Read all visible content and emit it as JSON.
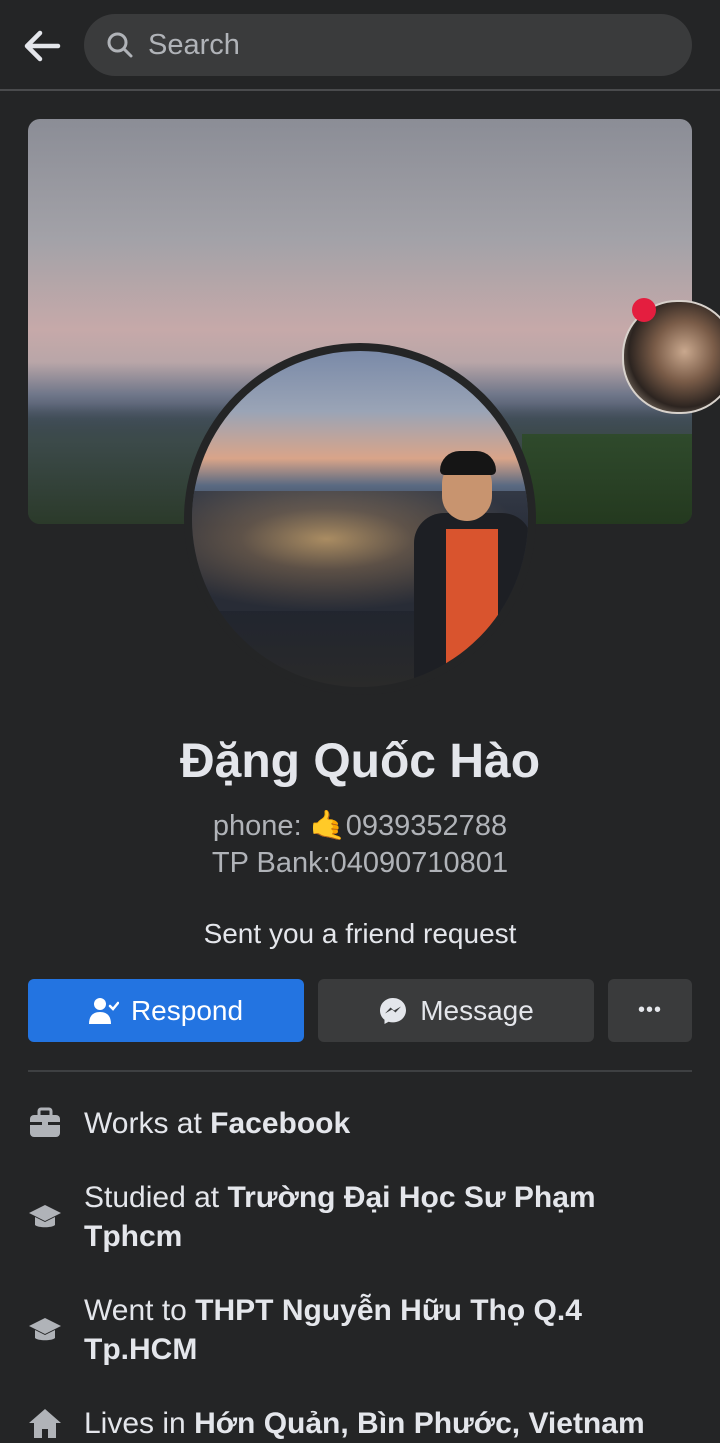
{
  "header": {
    "search_placeholder": "Search",
    "back_icon": "arrow-left-icon",
    "search_icon": "search-icon"
  },
  "profile": {
    "name": "Đặng Quốc Hào",
    "phone_line": "phone: 🤙0939352788",
    "bank_line": "TP Bank:04090710801",
    "request_text": "Sent you a friend request"
  },
  "actions": {
    "respond_label": "Respond",
    "message_label": "Message",
    "more_label": "•••"
  },
  "details": [
    {
      "icon": "briefcase-icon",
      "prefix": "Works at ",
      "value": "Facebook"
    },
    {
      "icon": "graduation-cap-icon",
      "prefix": "Studied at ",
      "value": "Trường Đại Học Sư Phạm Tphcm"
    },
    {
      "icon": "graduation-cap-icon",
      "prefix": "Went to ",
      "value": "THPT Nguyễn Hữu Thọ Q.4 Tp.HCM"
    },
    {
      "icon": "home-icon",
      "prefix": "Lives in ",
      "value": "Hớn Quản, Bìn Phước, Vietnam"
    }
  ],
  "colors": {
    "background": "#242526",
    "primary": "#2374e1",
    "secondary_button": "#3a3b3c",
    "text": "#e4e6eb",
    "muted_text": "#b0b3b8",
    "notification_badge": "#e41e3f"
  }
}
